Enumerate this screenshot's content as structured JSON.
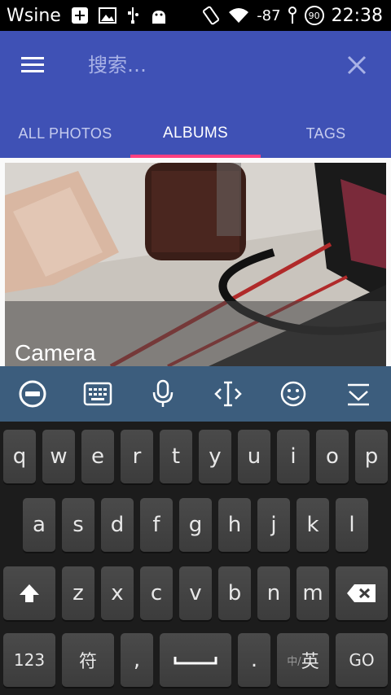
{
  "status_bar": {
    "carrier": "Wsine",
    "signal_text": "-87",
    "battery": "90",
    "time": "22:38"
  },
  "app_bar": {
    "search_placeholder": "搜索…",
    "tabs": [
      {
        "label": "ALL PHOTOS"
      },
      {
        "label": "ALBUMS"
      },
      {
        "label": "TAGS"
      }
    ]
  },
  "albums": [
    {
      "title": "Camera"
    }
  ],
  "keyboard": {
    "row1": [
      "q",
      "w",
      "e",
      "r",
      "t",
      "y",
      "u",
      "i",
      "o",
      "p"
    ],
    "row2": [
      "a",
      "s",
      "d",
      "f",
      "g",
      "h",
      "j",
      "k",
      "l"
    ],
    "row3": [
      "z",
      "x",
      "c",
      "v",
      "b",
      "n",
      "m"
    ],
    "num_key": "123",
    "symbol_key": "符",
    "comma_key": ",",
    "period_key": ".",
    "lang_key_small": "中/",
    "lang_key": "英",
    "go_key": "GO"
  },
  "colors": {
    "primary": "#3f51b5",
    "accent": "#ff4081",
    "toolbar": "#3c5d7d"
  }
}
